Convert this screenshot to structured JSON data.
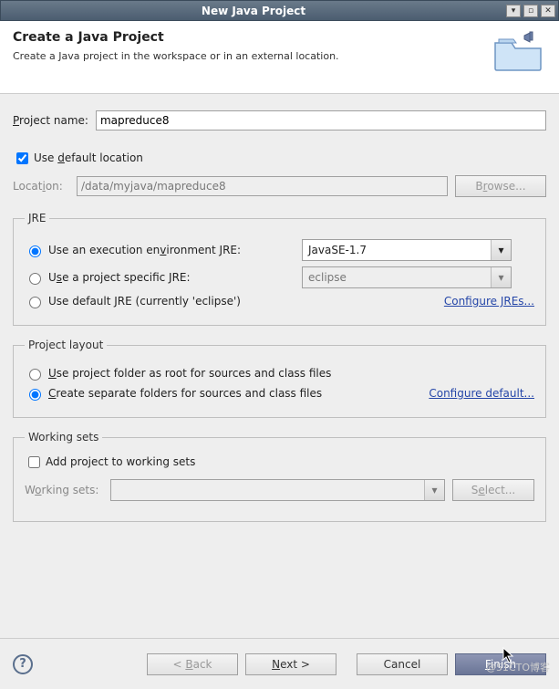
{
  "window": {
    "title": "New Java Project"
  },
  "header": {
    "title": "Create a Java Project",
    "subtitle": "Create a Java project in the workspace or in an external location."
  },
  "project": {
    "name_label": "Project name:",
    "name_value": "mapreduce8",
    "use_default_label": "Use default location",
    "use_default_checked": true,
    "location_label": "Location:",
    "location_value": "/data/myjava/mapreduce8",
    "browse_label": "Browse..."
  },
  "jre": {
    "legend": "JRE",
    "opt_exec_env_label": "Use an execution environment JRE:",
    "exec_env_value": "JavaSE-1.7",
    "opt_project_specific_label": "Use a project specific JRE:",
    "project_specific_value": "eclipse",
    "opt_default_label": "Use default JRE (currently 'eclipse')",
    "configure_link": "Configure JREs...",
    "selected": "exec_env"
  },
  "layout": {
    "legend": "Project layout",
    "opt_root_label": "Use project folder as root for sources and class files",
    "opt_separate_label": "Create separate folders for sources and class files",
    "configure_link": "Configure default...",
    "selected": "separate"
  },
  "working_sets": {
    "legend": "Working sets",
    "add_label": "Add project to working sets",
    "add_checked": false,
    "ws_label": "Working sets:",
    "ws_value": "",
    "select_label": "Select..."
  },
  "footer": {
    "back": "< Back",
    "next": "Next >",
    "cancel": "Cancel",
    "finish": "Finish"
  },
  "watermark": "@51CTO博客"
}
